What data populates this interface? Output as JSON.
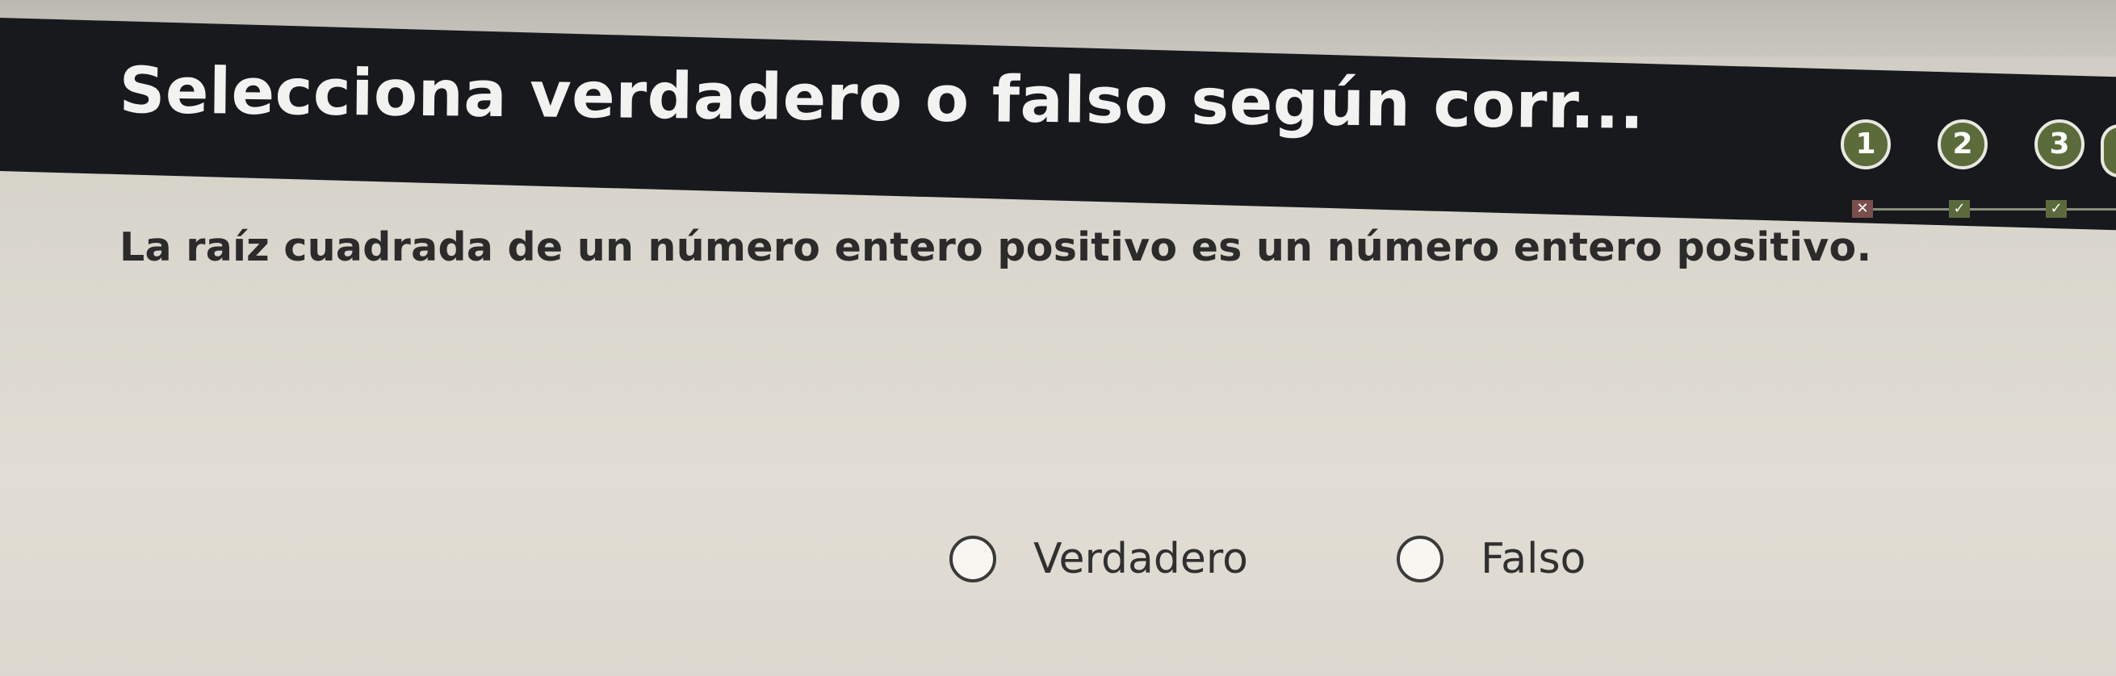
{
  "header": {
    "title": "Selecciona verdadero o falso según corr..."
  },
  "progress": {
    "steps": [
      {
        "number": "1",
        "status": "incorrect",
        "icon": "x-mark-icon"
      },
      {
        "number": "2",
        "status": "correct",
        "icon": "check-mark-icon"
      },
      {
        "number": "3",
        "status": "correct",
        "icon": "check-mark-icon"
      }
    ]
  },
  "question": {
    "text": "La raíz cuadrada de un número entero positivo es un número entero positivo."
  },
  "options": [
    {
      "label": "Verdadero",
      "selected": false
    },
    {
      "label": "Falso",
      "selected": false
    }
  ],
  "colors": {
    "header_background": "#17191d",
    "page_background": "#dcd8cf",
    "step_fill": "#5c6b3a"
  }
}
